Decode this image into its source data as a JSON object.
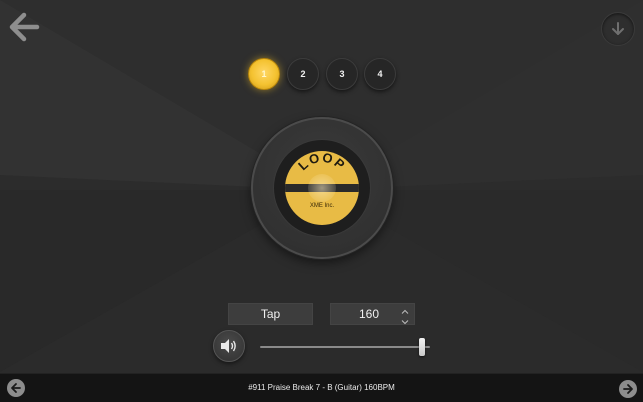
{
  "header": {
    "back_icon": "arrow-left-icon",
    "download_icon": "arrow-down-icon"
  },
  "pages": {
    "items": [
      "1",
      "2",
      "3",
      "4"
    ],
    "active_index": 0,
    "active_color": "#f4c230"
  },
  "loop_pad": {
    "title": "LOOP",
    "subtitle": "XME Inc.",
    "label_color": "#e8bb45"
  },
  "controls": {
    "tap_label": "Tap",
    "bpm_value": "160",
    "stepper_up_icon": "chevron-up-icon",
    "stepper_down_icon": "chevron-down-icon",
    "volume_icon": "speaker-icon",
    "volume_level": 0.97
  },
  "footer": {
    "track_title": "#911 Praise Break 7 - B (Guitar) 160BPM",
    "prev_icon": "arrow-left-icon",
    "next_icon": "arrow-right-icon"
  }
}
